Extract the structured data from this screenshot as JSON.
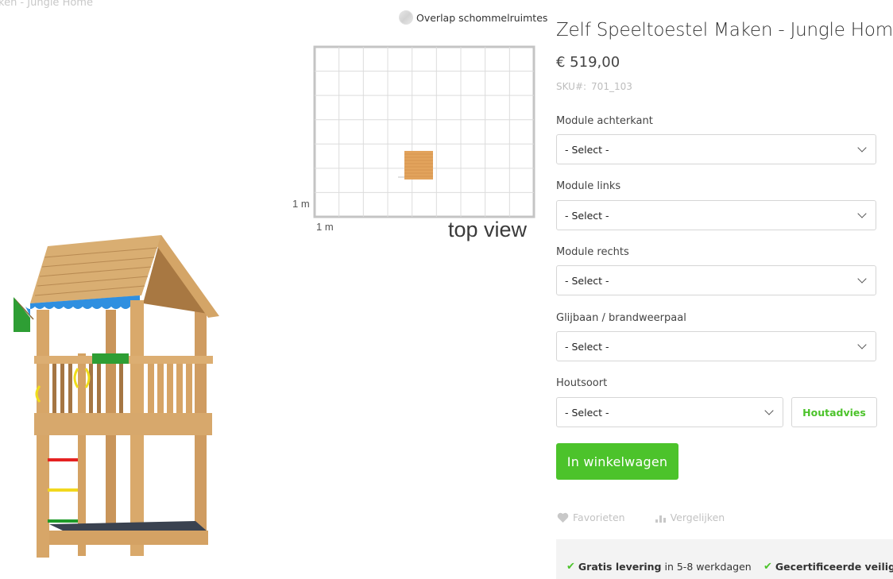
{
  "page": {
    "ghost_title": "ken - Jungle Home"
  },
  "overlap_toggle": {
    "label": "Overlap schommelruimtes",
    "checked": false
  },
  "top_view": {
    "title": "top view",
    "scale_x_label": "1 m",
    "scale_y_label": "1 m",
    "grid_columns": 9,
    "grid_rows": 7
  },
  "product": {
    "title": "Zelf Speeltoestel Maken - Jungle Home",
    "price": "€ 519,00",
    "sku_label": "SKU#:",
    "sku_value": "701_103",
    "image_alt": "Jungle Home speeltoestel"
  },
  "options": [
    {
      "label": "Module achterkant",
      "value": "- Select -"
    },
    {
      "label": "Module links",
      "value": "- Select -"
    },
    {
      "label": "Module rechts",
      "value": "- Select -"
    },
    {
      "label": "Glijbaan / brandweerpaal",
      "value": "- Select -"
    },
    {
      "label": "Houtsoort",
      "value": "- Select -"
    }
  ],
  "buttons": {
    "houtadvies": "Houtadvies",
    "add_to_cart": "In winkelwagen",
    "favorites": "Favorieten",
    "compare": "Vergelijken"
  },
  "benefits": [
    {
      "bold": "Gratis levering",
      "rest": " in 5-8 werkdagen"
    },
    {
      "bold": "Gecertificeerde veilighe",
      "rest": ""
    }
  ],
  "colors": {
    "accent_green": "#4cc32b",
    "muted_text": "#bdbdbd",
    "benefits_bg": "#f3f3f3"
  }
}
